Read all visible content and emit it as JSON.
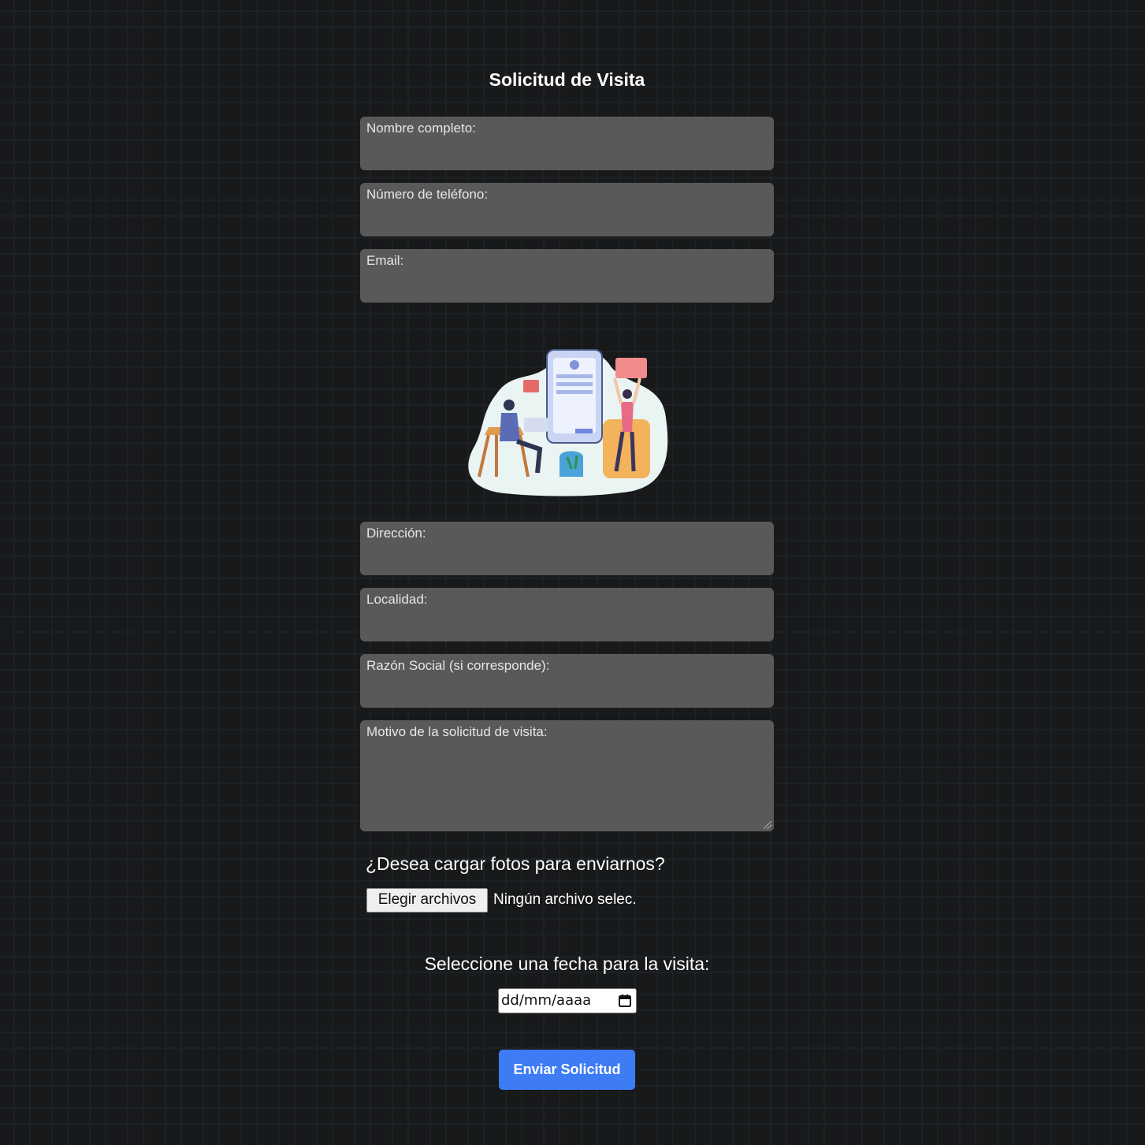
{
  "form": {
    "title": "Solicitud de Visita",
    "fields": {
      "nombre": "Nombre completo:",
      "telefono": "Número de teléfono:",
      "email": "Email:",
      "direccion": "Dirección:",
      "localidad": "Localidad:",
      "razon_social": "Razón Social (si corresponde):",
      "motivo": "Motivo de la solicitud de visita:"
    },
    "photos": {
      "question": "¿Desea cargar fotos para enviarnos?",
      "button_label": "Elegir archivos",
      "status": "Ningún archivo selec."
    },
    "date": {
      "label": "Seleccione una fecha para la visita:",
      "placeholder": "dd/mm/aaaa",
      "icon": "calendar-icon"
    },
    "submit_label": "Enviar Solicitud"
  },
  "colors": {
    "background": "#17191b",
    "field_bg": "#5a595a",
    "accent": "#3d7cf5"
  }
}
